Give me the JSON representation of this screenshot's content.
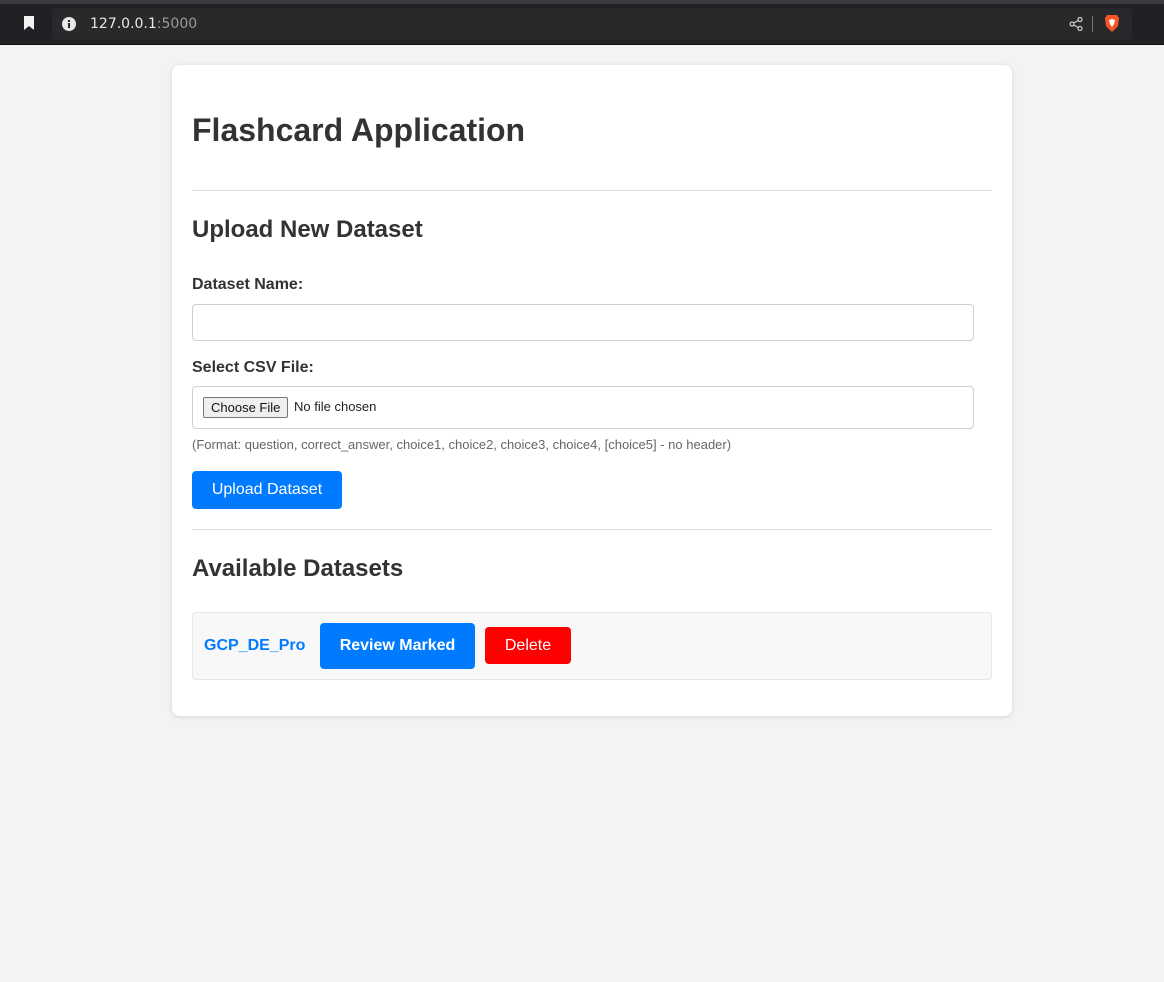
{
  "browser": {
    "url_host": "127.0.0.1",
    "url_port": ":5000"
  },
  "page": {
    "title": "Flashcard Application"
  },
  "upload": {
    "section_title": "Upload New Dataset",
    "name_label": "Dataset Name:",
    "name_value": "",
    "file_label": "Select CSV File:",
    "choose_file_label": "Choose File",
    "file_status": "No file chosen",
    "format_hint": "(Format: question, correct_answer, choice1, choice2, choice3, choice4, [choice5] - no header)",
    "submit_label": "Upload Dataset"
  },
  "datasets": {
    "section_title": "Available Datasets",
    "items": [
      {
        "name": "GCP_DE_Pro",
        "review_label": "Review Marked",
        "delete_label": "Delete"
      }
    ]
  },
  "colors": {
    "primary": "#007bff",
    "danger": "#ff0000",
    "background": "#f3f3f3"
  },
  "icons": [
    "bookmark-icon",
    "info-icon",
    "share-icon",
    "brave-icon"
  ]
}
